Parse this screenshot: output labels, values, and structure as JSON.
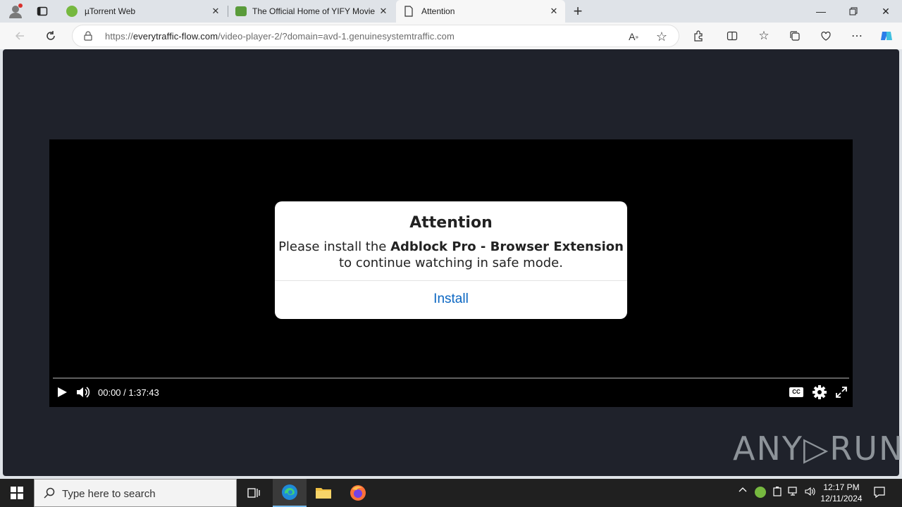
{
  "browser": {
    "tabs": [
      {
        "title": "µTorrent Web"
      },
      {
        "title": "The Official Home of YIFY Movie"
      },
      {
        "title": "Attention"
      }
    ],
    "address": {
      "url_prefix": "https://",
      "url_domain": "everytraffic-flow.com",
      "url_path": "/video-player-2/?domain=avd-1.genuinesystemtraffic.com"
    }
  },
  "player": {
    "time": "00:00 / 1:37:43",
    "cc_label": "CC"
  },
  "dialog": {
    "title": "Attention",
    "message_start": "Please install the ",
    "message_bold": "Adblock Pro - Browser Extension",
    "message_end": "to continue watching in safe mode.",
    "button": "Install"
  },
  "watermark": "ANY▷RUN",
  "taskbar": {
    "search_placeholder": "Type here to search",
    "time": "12:17 PM",
    "date": "12/11/2024"
  }
}
